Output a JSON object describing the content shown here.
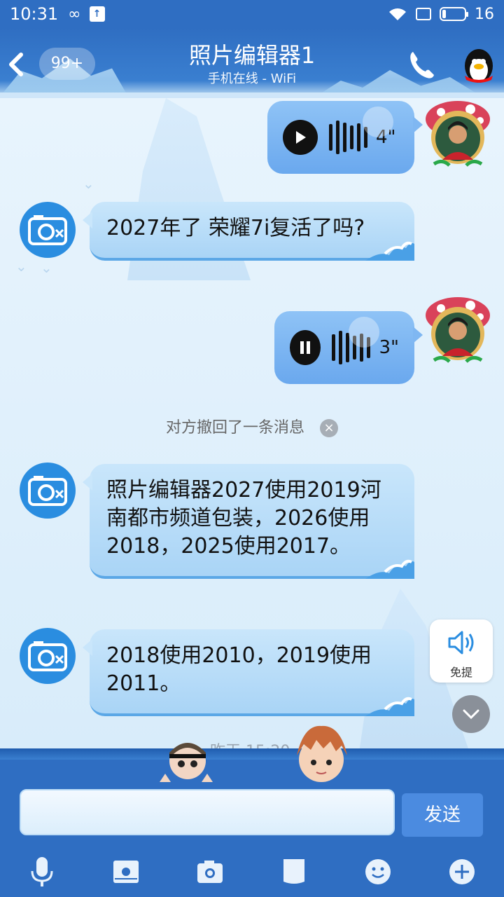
{
  "status_bar": {
    "time": "10:31",
    "battery": "16"
  },
  "header": {
    "unread_badge": "99+",
    "title": "照片编辑器1",
    "subtitle": "手机在线 - WiFi"
  },
  "messages": {
    "voice1_duration": "4\"",
    "text1": "2027年了 荣耀7i复活了吗?",
    "voice2_duration": "3\"",
    "recall_notice": "对方撤回了一条消息",
    "text2": "照片编辑器2027使用2019河南都市频道包装，2026使用2018，2025使用2017。",
    "text3": "2018使用2010，2019使用2011。",
    "timestamp": "昨天 15:20"
  },
  "speaker_button": {
    "label": "免提"
  },
  "composer": {
    "send_label": "发送"
  },
  "icons": {
    "back": "chevron-left-icon",
    "call": "phone-icon",
    "toolbar": [
      "microphone-icon",
      "image-icon",
      "camera-icon",
      "folder-icon",
      "emoji-icon",
      "plus-icon"
    ]
  },
  "colors": {
    "header_blue": "#2f6ec2",
    "bubble_left": "#b7dcf8",
    "bubble_voice": "#7fb7f2",
    "send_button": "#4b8be0"
  }
}
